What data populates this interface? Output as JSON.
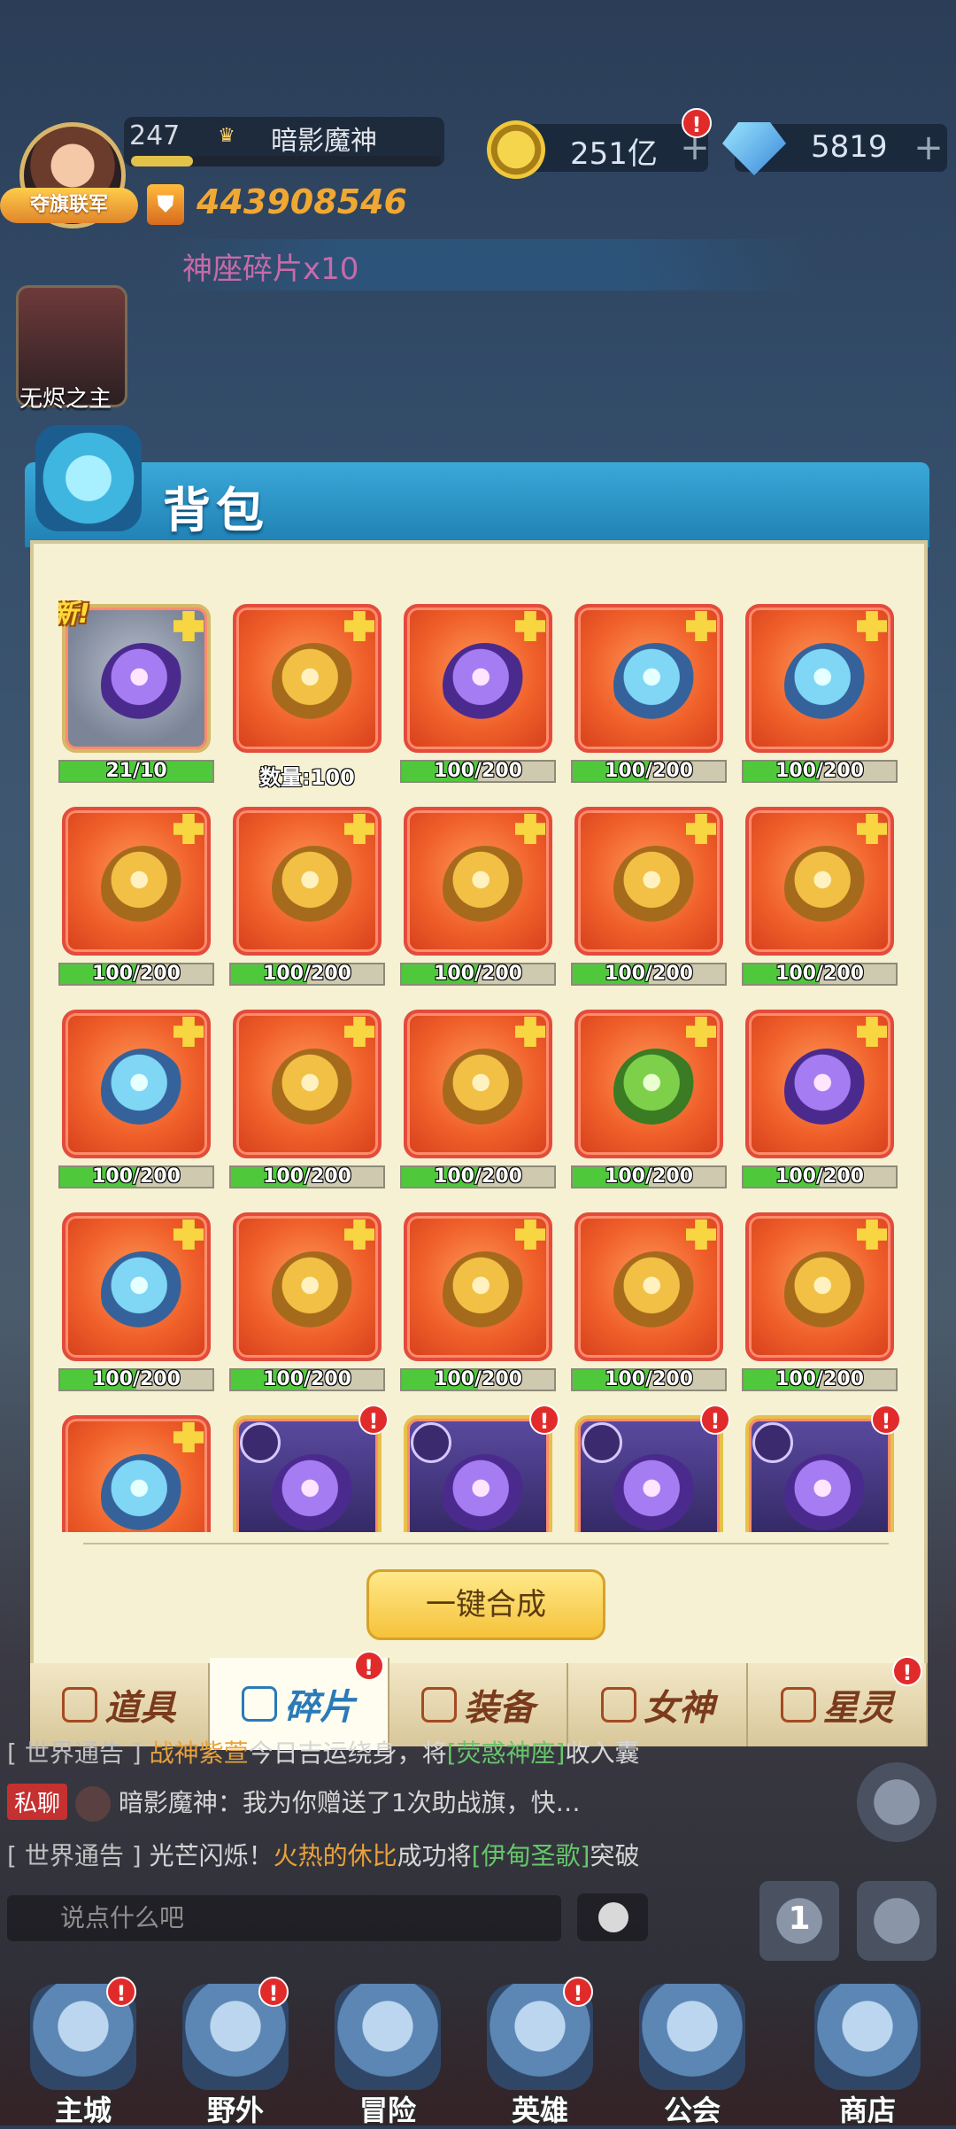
{
  "hud": {
    "level": "247",
    "rank_badge": "",
    "player_name": "暗影魔神",
    "exp_progress": 0.2,
    "alliance_tag": "夺旗联军",
    "power": "443908546",
    "gold": "251亿",
    "gold_alert": "!",
    "diamonds": "5819",
    "plus": "+",
    "notice": "神座碎片x10",
    "hero_portrait_label": "无烬之主"
  },
  "bag": {
    "title": "背包",
    "items": [
      {
        "type": "progress",
        "label": "21/10",
        "fill": 1.0,
        "is_new": true,
        "new_label": "新!",
        "tile": "gray",
        "art": "purple"
      },
      {
        "type": "qty",
        "label": "数量:100",
        "art": "gold"
      },
      {
        "type": "progress",
        "label": "100/200",
        "fill": 0.5,
        "art": "purple"
      },
      {
        "type": "progress",
        "label": "100/200",
        "fill": 0.5,
        "art": "blue"
      },
      {
        "type": "progress",
        "label": "100/200",
        "fill": 0.5,
        "art": "blue"
      },
      {
        "type": "progress",
        "label": "100/200",
        "fill": 0.5,
        "art": "gold"
      },
      {
        "type": "progress",
        "label": "100/200",
        "fill": 0.5,
        "art": "gold"
      },
      {
        "type": "progress",
        "label": "100/200",
        "fill": 0.5,
        "art": "gold"
      },
      {
        "type": "progress",
        "label": "100/200",
        "fill": 0.5,
        "art": "gold"
      },
      {
        "type": "progress",
        "label": "100/200",
        "fill": 0.5,
        "art": "gold"
      },
      {
        "type": "progress",
        "label": "100/200",
        "fill": 0.5,
        "art": "blue"
      },
      {
        "type": "progress",
        "label": "100/200",
        "fill": 0.5,
        "art": "gold"
      },
      {
        "type": "progress",
        "label": "100/200",
        "fill": 0.5,
        "art": "gold"
      },
      {
        "type": "progress",
        "label": "100/200",
        "fill": 0.5,
        "art": "green"
      },
      {
        "type": "progress",
        "label": "100/200",
        "fill": 0.5,
        "art": "purple"
      },
      {
        "type": "progress",
        "label": "100/200",
        "fill": 0.5,
        "art": "blue"
      },
      {
        "type": "progress",
        "label": "100/200",
        "fill": 0.5,
        "art": "gold"
      },
      {
        "type": "progress",
        "label": "100/200",
        "fill": 0.5,
        "art": "gold"
      },
      {
        "type": "progress",
        "label": "100/200",
        "fill": 0.5,
        "art": "gold"
      },
      {
        "type": "progress",
        "label": "100/200",
        "fill": 0.5,
        "art": "gold"
      },
      {
        "type": "partial",
        "art": "blue"
      },
      {
        "type": "hero",
        "alert": "!"
      },
      {
        "type": "hero",
        "alert": "!"
      },
      {
        "type": "hero",
        "alert": "!"
      },
      {
        "type": "hero",
        "alert": "!"
      }
    ],
    "compose_button": "一键合成",
    "tabs": [
      {
        "label": "道具",
        "active": false,
        "alert": ""
      },
      {
        "label": "碎片",
        "active": true,
        "alert": "!"
      },
      {
        "label": "装备",
        "active": false,
        "alert": ""
      },
      {
        "label": "女神",
        "active": false,
        "alert": ""
      },
      {
        "label": "星灵",
        "active": false,
        "alert": "!"
      }
    ]
  },
  "chat": {
    "line1": {
      "channel": "[ 世界通告 ]",
      "gold": "战神紫萱",
      "text": "今日吉运绕身，将",
      "green": "[荧惑神座]",
      "tail": "收入囊"
    },
    "line2": {
      "channel": "私聊",
      "name": "暗影魔神：",
      "text": "我为你赠送了1次助战旗，快…"
    },
    "line3": {
      "channel": "[ 世界通告 ]",
      "text1": "光芒闪烁！",
      "gold": "火热的休比",
      "text2": "成功将",
      "green": "[伊甸圣歌]",
      "tail": "突破"
    },
    "input_placeholder": "说点什么吧",
    "rank_marker": "1"
  },
  "nav": {
    "items": [
      {
        "label": "主城",
        "alert": "!"
      },
      {
        "label": "野外",
        "alert": "!"
      },
      {
        "label": "冒险",
        "alert": ""
      },
      {
        "label": "英雄",
        "alert": "!"
      },
      {
        "label": "公会",
        "alert": ""
      },
      {
        "label": "商店",
        "alert": ""
      }
    ]
  },
  "colors": {
    "accent": "#1f7fb3",
    "tile_red": "#f0602a",
    "progress_green": "#4fc93b",
    "alert_red": "#e12b2b"
  }
}
